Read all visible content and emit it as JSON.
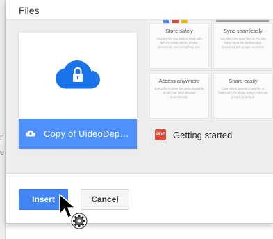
{
  "background": {
    "letters": [
      "r",
      "e"
    ]
  },
  "dialog": {
    "title": "Files",
    "buttons": {
      "insert": "Insert",
      "cancel": "Cancel"
    }
  },
  "files": [
    {
      "name": "Copy of UideoDepot...",
      "icon": "lock-cloud-icon",
      "selected": true
    },
    {
      "name": "Getting started",
      "icon": "pdf-icon",
      "badge": "PDF",
      "selected": false,
      "preview": {
        "tiles": [
          {
            "title": "Store safely",
            "body": "Add any file you want to keep safe with the Drive button, photos, documents, and everything else."
          },
          {
            "title": "Sync seamlessly",
            "body": "Get files from your files on PC into Drive using the desktop app. Download it at google.com/drive"
          },
          {
            "title": "Access anywhere",
            "body": "Every file in Drive becomes available on all your other devices automatically."
          },
          {
            "title": "Share easily",
            "body": "Give others access to any file or folder with the Share button. Files are private by default."
          }
        ]
      }
    }
  ],
  "colors": {
    "selected_blue": "#4d90fe",
    "insert_blue": "#4285f4",
    "pdf_red": "#dd4b39"
  }
}
